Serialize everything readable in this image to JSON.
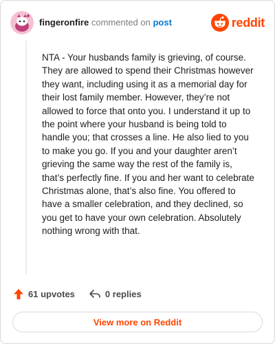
{
  "header": {
    "username": "fingeronfire",
    "action_text": "commented on",
    "target_link": "post",
    "brand": "reddit"
  },
  "comment": {
    "body": "NTA - Your husbands family is grieving, of course. They are allowed to spend their Christmas however they want, including using it as a memorial day for their lost family member. However, they’re not allowed to force that onto you. I understand it up to the point where your husband is being told to handle you; that crosses a line. He also lied to you to make you go. If you and your daughter aren’t grieving the same way the rest of the family is, that’s perfectly fine. If you and her want to celebrate Christmas alone, that’s also fine. You offered to have a smaller celebration, and they declined, so you get to have your own celebration. Absolutely nothing wrong with that."
  },
  "actions": {
    "upvotes": "61 upvotes",
    "replies": "0 replies"
  },
  "footer": {
    "view_more": "View more on Reddit"
  },
  "icons": {
    "avatar": "snoo-avatar-icon",
    "brand": "reddit-logo-icon",
    "upvote": "upvote-arrow-icon",
    "reply": "reply-arrow-icon"
  },
  "colors": {
    "brand": "#ff4500",
    "link": "#0079d3",
    "muted": "#7c7c7c",
    "avatar_bg": "#f3c1d3"
  }
}
